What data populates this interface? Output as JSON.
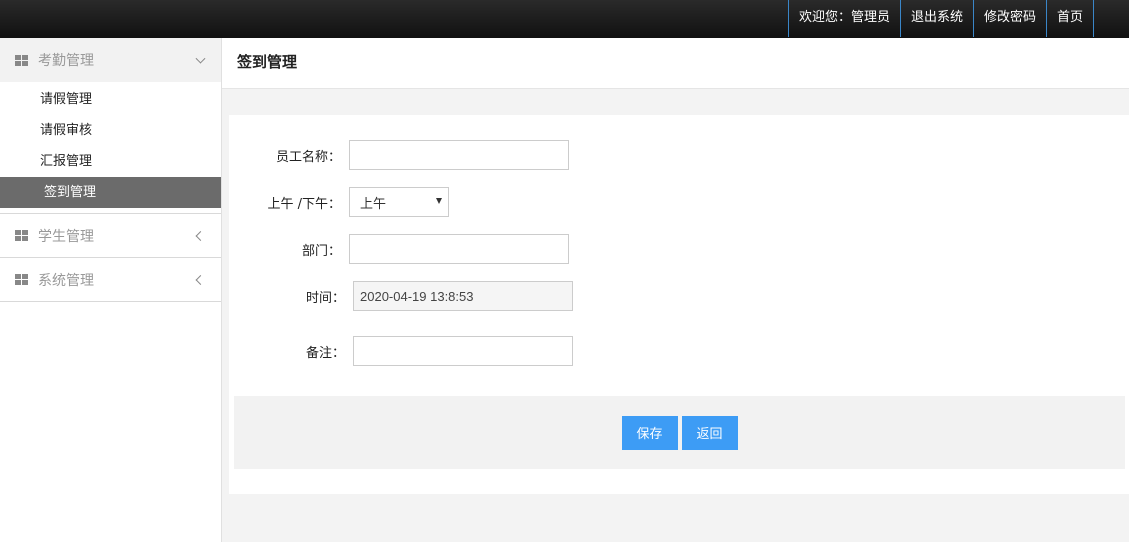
{
  "topnav": {
    "welcome": "欢迎您：管理员",
    "logout": "退出系统",
    "change_password": "修改密码",
    "home": "首页"
  },
  "sidebar": {
    "groups": [
      {
        "label": "考勤管理",
        "expanded": true,
        "items": [
          {
            "label": "请假管理"
          },
          {
            "label": "请假审核"
          },
          {
            "label": "汇报管理"
          },
          {
            "label": "签到管理",
            "active": true
          }
        ]
      },
      {
        "label": "学生管理",
        "expanded": false
      },
      {
        "label": "系统管理",
        "expanded": false
      }
    ]
  },
  "page": {
    "title": "签到管理"
  },
  "form": {
    "employee_name": {
      "label": "员工名称：",
      "value": ""
    },
    "period": {
      "label": "上午 /下午：",
      "selected": "上午"
    },
    "department": {
      "label": "部门：",
      "value": ""
    },
    "time": {
      "label": "时间：",
      "value": "2020-04-19 13:8:53"
    },
    "remark": {
      "label": "备注：",
      "value": ""
    }
  },
  "actions": {
    "save": "保存",
    "back": "返回"
  },
  "colors": {
    "topbar": "#1a1a1a",
    "active_menu": "#6b6b6b",
    "button": "#3d9cf5",
    "nav_divider": "#3a86c8"
  }
}
